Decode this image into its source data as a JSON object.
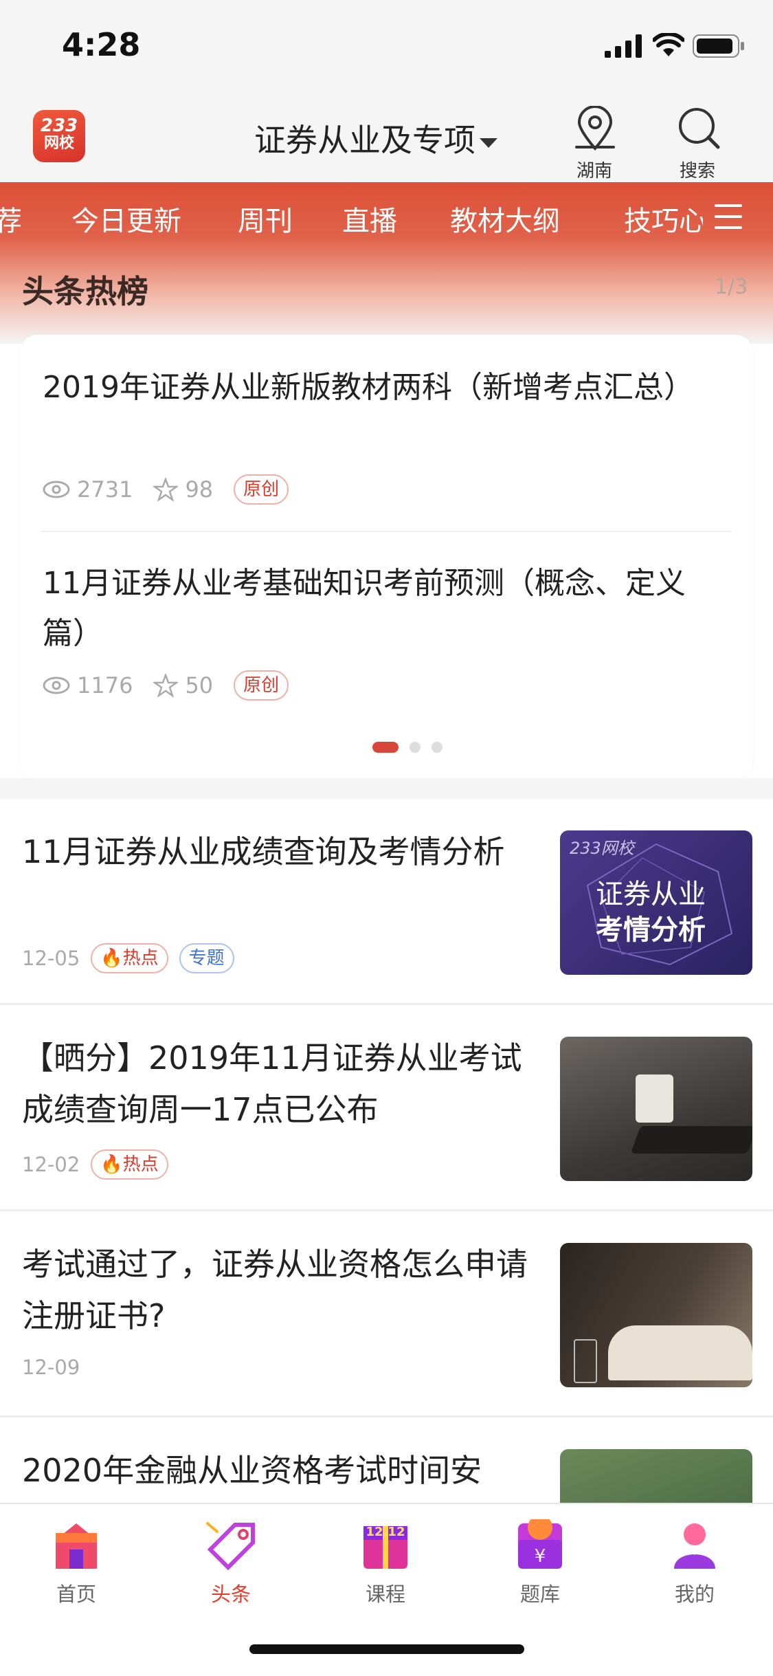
{
  "status": {
    "time": "4:28"
  },
  "header": {
    "logo_top": "233",
    "logo_bottom": "网校",
    "title": "证券从业及专项",
    "location_label": "湖南",
    "search_label": "搜索"
  },
  "tabs": [
    "荐",
    "今日更新",
    "周刊",
    "直播",
    "教材大纲",
    "技巧心"
  ],
  "hot": {
    "title": "头条热榜",
    "page": "1/3",
    "items": [
      {
        "title": "2019年证券从业新版教材两科（新增考点汇总）",
        "views": "2731",
        "stars": "98",
        "tag": "原创"
      },
      {
        "title": "11月证券从业考基础知识考前预测（概念、定义篇）",
        "views": "1176",
        "stars": "50",
        "tag": "原创"
      }
    ]
  },
  "news": [
    {
      "title": "11月证券从业成绩查询及考情分析",
      "date": "12-05",
      "tags": [
        "热点",
        "专题"
      ],
      "thumb_brand": "233网校",
      "thumb_line1": "证券从业",
      "thumb_line2": "考情分析"
    },
    {
      "title": "【晒分】2019年11月证券从业考试成绩查询周一17点已公布",
      "date": "12-02",
      "tags": [
        "热点"
      ]
    },
    {
      "title": "考试通过了，证券从业资格怎么申请注册证书?",
      "date": "12-09",
      "tags": []
    },
    {
      "title": "2020年金融从业资格考试时间安",
      "date": "",
      "tags": []
    }
  ],
  "tabbar": {
    "items": [
      {
        "label": "首页",
        "icon": "home-icon"
      },
      {
        "label": "头条",
        "icon": "tag-icon"
      },
      {
        "label": "课程",
        "icon": "gift-icon"
      },
      {
        "label": "题库",
        "icon": "yuan-icon"
      },
      {
        "label": "我的",
        "icon": "profile-icon"
      }
    ],
    "active": "头条",
    "course_badge": "12.12"
  },
  "colors": {
    "accent": "#e63b2b",
    "band": "#dd4f38"
  }
}
